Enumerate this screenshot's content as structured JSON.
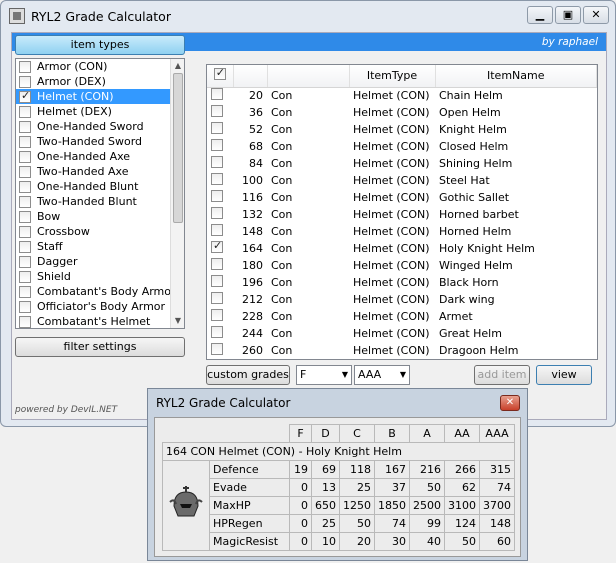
{
  "window": {
    "title": "RYL2 Grade Calculator",
    "banner": "by raphael",
    "caption": [
      "▁",
      "▣",
      "✕"
    ]
  },
  "left": {
    "item_types_label": "item types",
    "filter_label": "filter settings",
    "items": [
      {
        "label": "Armor (CON)",
        "checked": false
      },
      {
        "label": "Armor (DEX)",
        "checked": false
      },
      {
        "label": "Helmet (CON)",
        "checked": true,
        "selected": true
      },
      {
        "label": "Helmet (DEX)",
        "checked": false
      },
      {
        "label": "One-Handed Sword",
        "checked": false
      },
      {
        "label": "Two-Handed Sword",
        "checked": false
      },
      {
        "label": "One-Handed Axe",
        "checked": false
      },
      {
        "label": "Two-Handed Axe",
        "checked": false
      },
      {
        "label": "One-Handed Blunt",
        "checked": false
      },
      {
        "label": "Two-Handed Blunt",
        "checked": false
      },
      {
        "label": "Bow",
        "checked": false
      },
      {
        "label": "Crossbow",
        "checked": false
      },
      {
        "label": "Staff",
        "checked": false
      },
      {
        "label": "Dagger",
        "checked": false
      },
      {
        "label": "Shield",
        "checked": false
      },
      {
        "label": "Combatant's Body Armor",
        "checked": false
      },
      {
        "label": "Officiator's Body Armor",
        "checked": false
      },
      {
        "label": "Combatant's Helmet",
        "checked": false
      }
    ]
  },
  "grid": {
    "headers": [
      "",
      "",
      "ItemType",
      "ItemName"
    ],
    "rows": [
      {
        "num": "20",
        "type": "Con",
        "itype": "Helmet (CON)",
        "name": "Chain Helm",
        "checked": false
      },
      {
        "num": "36",
        "type": "Con",
        "itype": "Helmet (CON)",
        "name": "Open Helm",
        "checked": false
      },
      {
        "num": "52",
        "type": "Con",
        "itype": "Helmet (CON)",
        "name": "Knight Helm",
        "checked": false
      },
      {
        "num": "68",
        "type": "Con",
        "itype": "Helmet (CON)",
        "name": "Closed Helm",
        "checked": false
      },
      {
        "num": "84",
        "type": "Con",
        "itype": "Helmet (CON)",
        "name": "Shining Helm",
        "checked": false
      },
      {
        "num": "100",
        "type": "Con",
        "itype": "Helmet (CON)",
        "name": "Steel Hat",
        "checked": false
      },
      {
        "num": "116",
        "type": "Con",
        "itype": "Helmet (CON)",
        "name": "Gothic Sallet",
        "checked": false
      },
      {
        "num": "132",
        "type": "Con",
        "itype": "Helmet (CON)",
        "name": "Horned barbet",
        "checked": false
      },
      {
        "num": "148",
        "type": "Con",
        "itype": "Helmet (CON)",
        "name": "Horned Helm",
        "checked": false
      },
      {
        "num": "164",
        "type": "Con",
        "itype": "Helmet (CON)",
        "name": "Holy Knight Helm",
        "checked": true
      },
      {
        "num": "180",
        "type": "Con",
        "itype": "Helmet (CON)",
        "name": "Winged Helm",
        "checked": false
      },
      {
        "num": "196",
        "type": "Con",
        "itype": "Helmet (CON)",
        "name": "Black Horn",
        "checked": false
      },
      {
        "num": "212",
        "type": "Con",
        "itype": "Helmet (CON)",
        "name": "Dark wing",
        "checked": false
      },
      {
        "num": "228",
        "type": "Con",
        "itype": "Helmet (CON)",
        "name": "Armet",
        "checked": false
      },
      {
        "num": "244",
        "type": "Con",
        "itype": "Helmet (CON)",
        "name": "Great Helm",
        "checked": false
      },
      {
        "num": "260",
        "type": "Con",
        "itype": "Helmet (CON)",
        "name": "Dragoon Helm",
        "checked": false
      }
    ]
  },
  "bottom": {
    "custom_label": "custom grades",
    "combo1": "F",
    "combo2": "AAA",
    "add_label": "add item",
    "view_label": "view"
  },
  "powered": "powered by DevIL.NET",
  "sub": {
    "title": "RYL2 Grade Calculator",
    "close": "✕",
    "grades": [
      "F",
      "D",
      "C",
      "B",
      "A",
      "AA",
      "AAA"
    ],
    "item": "164 CON Helmet (CON) - Holy Knight Helm",
    "stats": [
      {
        "name": "Defence",
        "values": [
          "19",
          "69",
          "118",
          "167",
          "216",
          "266",
          "315"
        ]
      },
      {
        "name": "Evade",
        "values": [
          "0",
          "13",
          "25",
          "37",
          "50",
          "62",
          "74"
        ]
      },
      {
        "name": "MaxHP",
        "values": [
          "0",
          "650",
          "1250",
          "1850",
          "2500",
          "3100",
          "3700"
        ]
      },
      {
        "name": "HPRegen",
        "values": [
          "0",
          "25",
          "50",
          "74",
          "99",
          "124",
          "148"
        ]
      },
      {
        "name": "MagicResist",
        "values": [
          "0",
          "10",
          "20",
          "30",
          "40",
          "50",
          "60"
        ]
      }
    ]
  }
}
